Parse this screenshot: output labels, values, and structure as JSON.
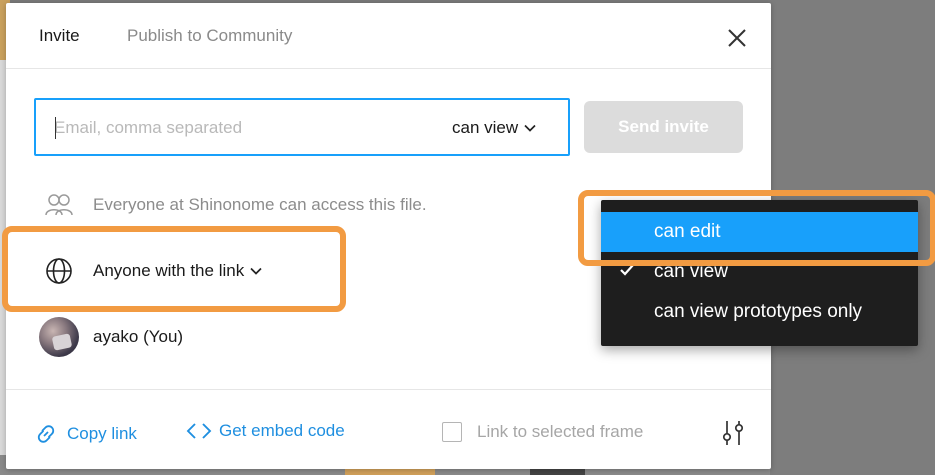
{
  "dialog": {
    "tabs": [
      {
        "label": "Invite",
        "active": true
      },
      {
        "label": "Publish to Community",
        "active": false
      }
    ],
    "close_icon": "close-icon"
  },
  "invite": {
    "email_placeholder": "Email, comma separated",
    "email_value": "",
    "permission_label": "can view",
    "send_label": "Send invite"
  },
  "access": {
    "org_text": "Everyone at Shinonome can access this file.",
    "link_access_label": "Anyone with the link",
    "user_name": "ayako (You)"
  },
  "footer": {
    "copy_link_label": "Copy link",
    "embed_label": "Get embed code",
    "frame_checkbox_label": "Link to selected frame",
    "frame_checkbox_checked": false
  },
  "dropdown": {
    "options": [
      {
        "label": "can edit",
        "highlighted": true,
        "checked": false
      },
      {
        "label": "can view",
        "highlighted": false,
        "checked": true
      },
      {
        "label": "can view prototypes only",
        "highlighted": false,
        "checked": false
      }
    ]
  },
  "colors": {
    "accent": "#18a0fb",
    "link": "#1f8fe0",
    "annotation": "#f29b42",
    "dropdown_bg": "#1e1e1e"
  }
}
